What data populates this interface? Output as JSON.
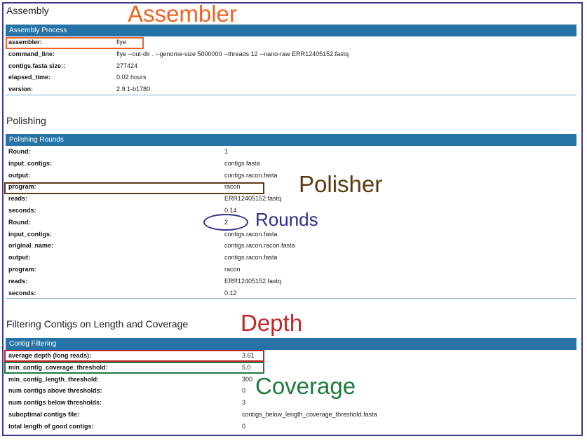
{
  "assembly": {
    "title": "Assembly",
    "bar_label": "Assembly Process",
    "rows": [
      {
        "key": "assembler:",
        "value": "flye"
      },
      {
        "key": "command_line:",
        "value": "flye --out-dir . --genome-size 5000000 --threads 12 --nano-raw ERR12405152.fastq"
      },
      {
        "key": "contigs.fasta size::",
        "value": "277424"
      },
      {
        "key": "elapsed_time:",
        "value": "0.02 hours"
      },
      {
        "key": "version:",
        "value": "2.9.1-b1780"
      }
    ]
  },
  "polishing": {
    "title": "Polishing",
    "bar_label": "Polishing Rounds",
    "rows": [
      {
        "key": "Round:",
        "value": "1"
      },
      {
        "key": "input_contigs:",
        "value": "contigs.fasta"
      },
      {
        "key": "output:",
        "value": "contigs.racon.fasta"
      },
      {
        "key": "program:",
        "value": "racon"
      },
      {
        "key": "reads:",
        "value": "ERR12405152.fastq"
      },
      {
        "key": "seconds:",
        "value": "0.14"
      },
      {
        "key": "Round:",
        "value": "2"
      },
      {
        "key": "input_contigs:",
        "value": "contigs.racon.fasta"
      },
      {
        "key": "original_name:",
        "value": "contigs.racon.racon.fasta"
      },
      {
        "key": "output:",
        "value": "contigs.racon.fasta"
      },
      {
        "key": "program:",
        "value": "racon"
      },
      {
        "key": "reads:",
        "value": "ERR12405152.fastq"
      },
      {
        "key": "seconds:",
        "value": "0.12"
      }
    ]
  },
  "filtering": {
    "title": "Filtering Contigs on Length and Coverage",
    "bar_label": "Contig Filtering",
    "rows": [
      {
        "key": "average depth (long reads):",
        "value": "3.61"
      },
      {
        "key": "min_contig_coverage_threshold:",
        "value": "5.0"
      },
      {
        "key": "min_contig_length_threshold:",
        "value": "300"
      },
      {
        "key": "num contigs above thresholds:",
        "value": "0"
      },
      {
        "key": "num contigs below thresholds:",
        "value": "3"
      },
      {
        "key": "suboptimal contigs file:",
        "value": "contigs_below_length_coverage_threshold.fasta"
      },
      {
        "key": "total length of good contigs:",
        "value": "0"
      }
    ]
  },
  "annotations": {
    "assembler": {
      "text": "Assembler",
      "color": "#ef6423"
    },
    "polisher": {
      "text": "Polisher",
      "color": "#5c3a11"
    },
    "rounds": {
      "text": "Rounds",
      "color": "#2e2e8a"
    },
    "depth": {
      "text": "Depth",
      "color": "#c4262e"
    },
    "coverage": {
      "text": "Coverage",
      "color": "#1e7a3e"
    }
  }
}
